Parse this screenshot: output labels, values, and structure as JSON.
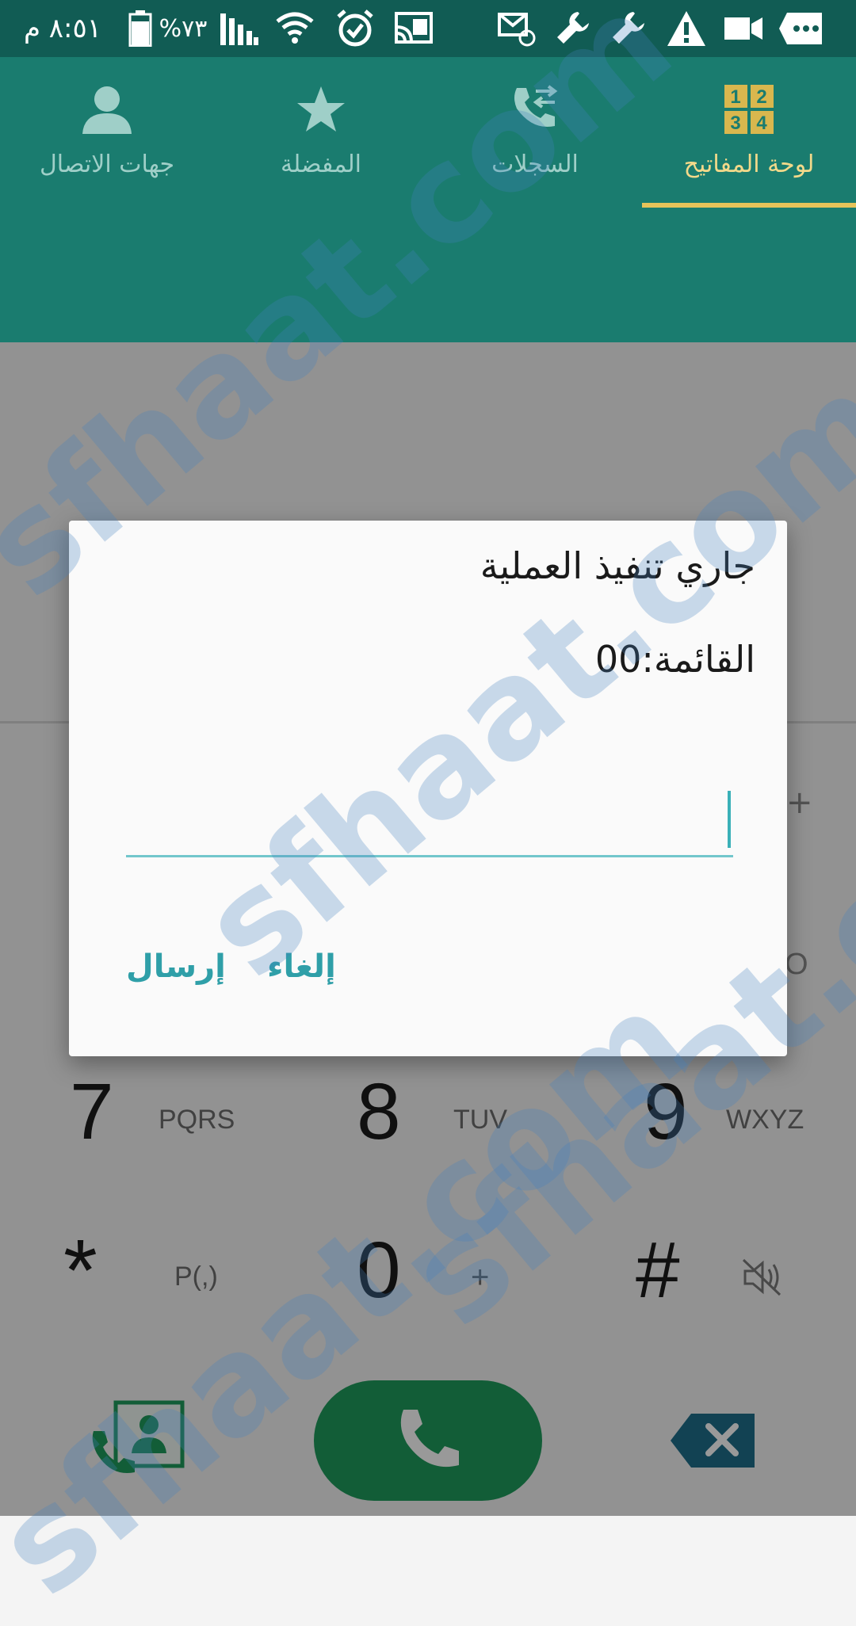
{
  "status_bar": {
    "time": "٨:٥١ م",
    "battery_percent": "%٧٣",
    "icons": [
      "battery-icon",
      "signal-icon",
      "wifi-icon",
      "alarm-icon",
      "cast-icon",
      "email-icon",
      "wrench-icon",
      "wrench-icon",
      "warning-icon",
      "video-icon",
      "chat-icon"
    ]
  },
  "tabs": [
    {
      "label": "لوحة المفاتيح",
      "icon": "keypad-icon",
      "active": true
    },
    {
      "label": "السجلات",
      "icon": "call-log-icon",
      "active": false
    },
    {
      "label": "المفضلة",
      "icon": "star-icon",
      "active": false
    },
    {
      "label": "جهات الاتصال",
      "icon": "contacts-icon",
      "active": false
    }
  ],
  "keypad": {
    "rows": [
      [
        {
          "digit": "7",
          "letters": "PQRS"
        },
        {
          "digit": "8",
          "letters": "TUV"
        },
        {
          "digit": "9",
          "letters": "WXYZ"
        }
      ],
      [
        {
          "digit": "*",
          "letters": "P(,)"
        },
        {
          "digit": "0",
          "letters": "+"
        },
        {
          "digit": "#",
          "letters": ""
        }
      ]
    ],
    "partial_right_edge": [
      "+",
      "O"
    ]
  },
  "bottom_bar": {
    "contact_icon": "contact-card-icon",
    "call_icon": "phone-icon",
    "delete_icon": "backspace-icon"
  },
  "dialog": {
    "title": "جاري تنفيذ العملية",
    "message": "القائمة:00",
    "input_value": "",
    "buttons": {
      "send": "إرسال",
      "cancel": "إلغاء"
    }
  },
  "colors": {
    "statusbar": "#115c54",
    "appbar": "#1a7c6f",
    "accent": "#e6c35a",
    "dialog_accent": "#2f9fa8",
    "call": "#1f9b5c"
  },
  "watermark": "sfhaat.com"
}
